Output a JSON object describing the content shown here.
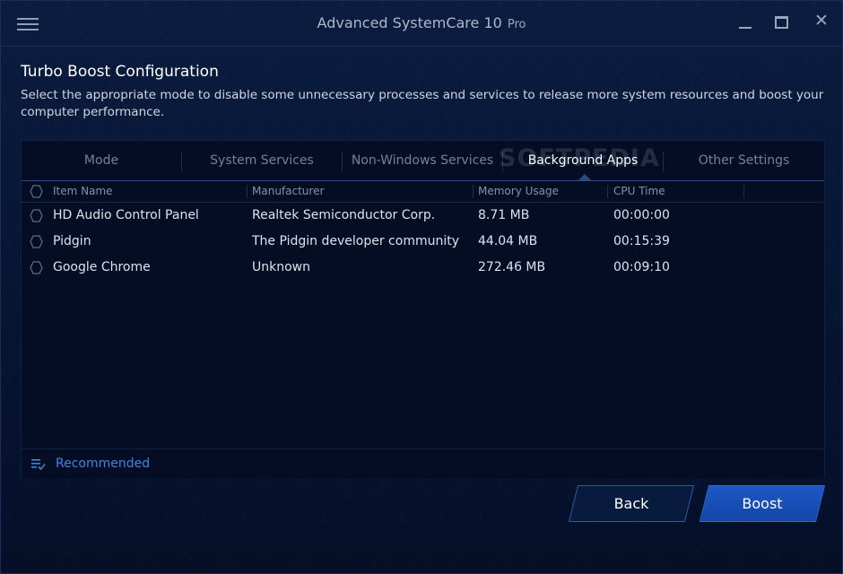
{
  "window": {
    "app_name": "Advanced SystemCare 10",
    "edition": "Pro"
  },
  "header": {
    "title": "Turbo Boost Configuration",
    "description": "Select the appropriate mode to disable some unnecessary processes and services to release more system resources and boost your computer performance."
  },
  "tabs": [
    {
      "label": "Mode",
      "active": false
    },
    {
      "label": "System Services",
      "active": false
    },
    {
      "label": "Non-Windows Services",
      "active": false
    },
    {
      "label": "Background Apps",
      "active": true
    },
    {
      "label": "Other Settings",
      "active": false
    }
  ],
  "watermark": "SOFTPEDIA",
  "table": {
    "columns": [
      "Item Name",
      "Manufacturer",
      "Memory Usage",
      "CPU Time"
    ],
    "rows": [
      {
        "name": "HD Audio Control Panel",
        "manufacturer": "Realtek Semiconductor Corp.",
        "memory": "8.71 MB",
        "cpu": "00:00:00",
        "checked": false
      },
      {
        "name": "Pidgin",
        "manufacturer": "The Pidgin developer community",
        "memory": "44.04 MB",
        "cpu": "00:15:39",
        "checked": false
      },
      {
        "name": "Google Chrome",
        "manufacturer": "Unknown",
        "memory": "272.46 MB",
        "cpu": "00:09:10",
        "checked": false
      }
    ]
  },
  "footer": {
    "recommended_label": "Recommended"
  },
  "buttons": {
    "back": "Back",
    "boost": "Boost"
  },
  "colors": {
    "background": "#061330",
    "accent": "#1d58c7",
    "link": "#3c86e0"
  }
}
